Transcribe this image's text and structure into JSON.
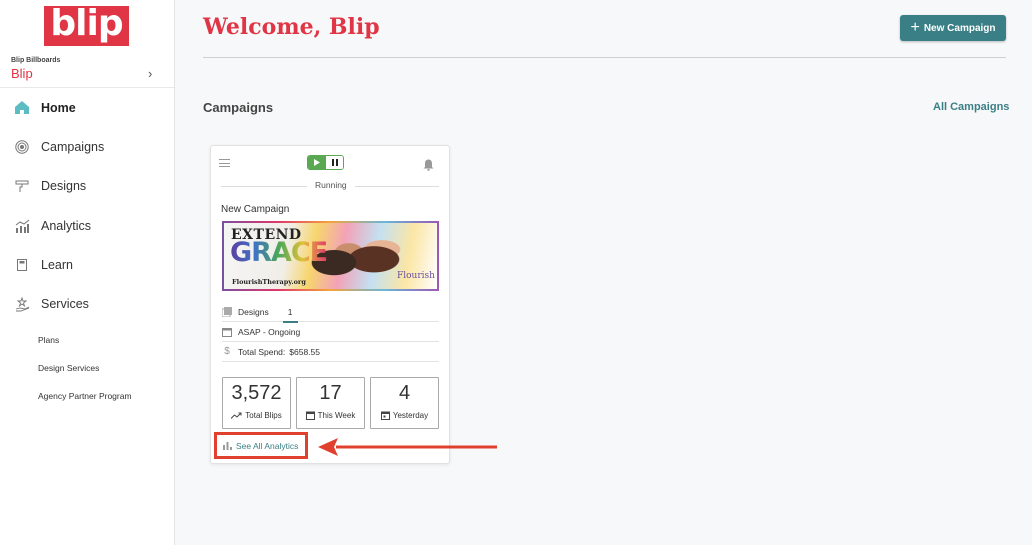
{
  "sidebar": {
    "logo_text": "blip",
    "account": {
      "org": "Blip Billboards",
      "name": "Blip",
      "chevron": "›"
    },
    "items": [
      {
        "label": "Home",
        "icon": "home-icon",
        "active": true
      },
      {
        "label": "Campaigns",
        "icon": "target-icon",
        "active": false
      },
      {
        "label": "Designs",
        "icon": "paint-roller-icon",
        "active": false
      },
      {
        "label": "Analytics",
        "icon": "chart-icon",
        "active": false
      },
      {
        "label": "Learn",
        "icon": "book-icon",
        "active": false
      },
      {
        "label": "Services",
        "icon": "hand-star-icon",
        "active": false
      }
    ],
    "subitems": [
      {
        "label": "Plans"
      },
      {
        "label": "Design Services"
      },
      {
        "label": "Agency Partner Program"
      }
    ]
  },
  "header": {
    "title": "Welcome, Blip",
    "new_campaign": {
      "icon": "+",
      "label": "New Campaign"
    }
  },
  "campaigns": {
    "section_title": "Campaigns",
    "all_link": "All Campaigns",
    "cards": [
      {
        "status": "Running",
        "name": "New Campaign",
        "banner": {
          "line1": "EXTEND",
          "line2": "GRACE",
          "url": "FlourishTherapy.org",
          "brand": "Flourish"
        },
        "designs_label": "Designs",
        "designs_count": "1",
        "schedule": "ASAP  -  Ongoing",
        "spend_label": "Total Spend:",
        "spend_value": "$658.55",
        "stats": [
          {
            "value": "3,572",
            "label": "Total Blips",
            "icon": "trend-up-icon"
          },
          {
            "value": "17",
            "label": "This Week",
            "icon": "calendar-icon"
          },
          {
            "value": "4",
            "label": "Yesterday",
            "icon": "calendar-day-icon"
          }
        ],
        "analytics_link": "See All Analytics"
      }
    ]
  },
  "colors": {
    "brand_red": "#e03545",
    "teal": "#3a7f86",
    "running_green": "#5aa852",
    "annotation_red": "#e0402e"
  }
}
